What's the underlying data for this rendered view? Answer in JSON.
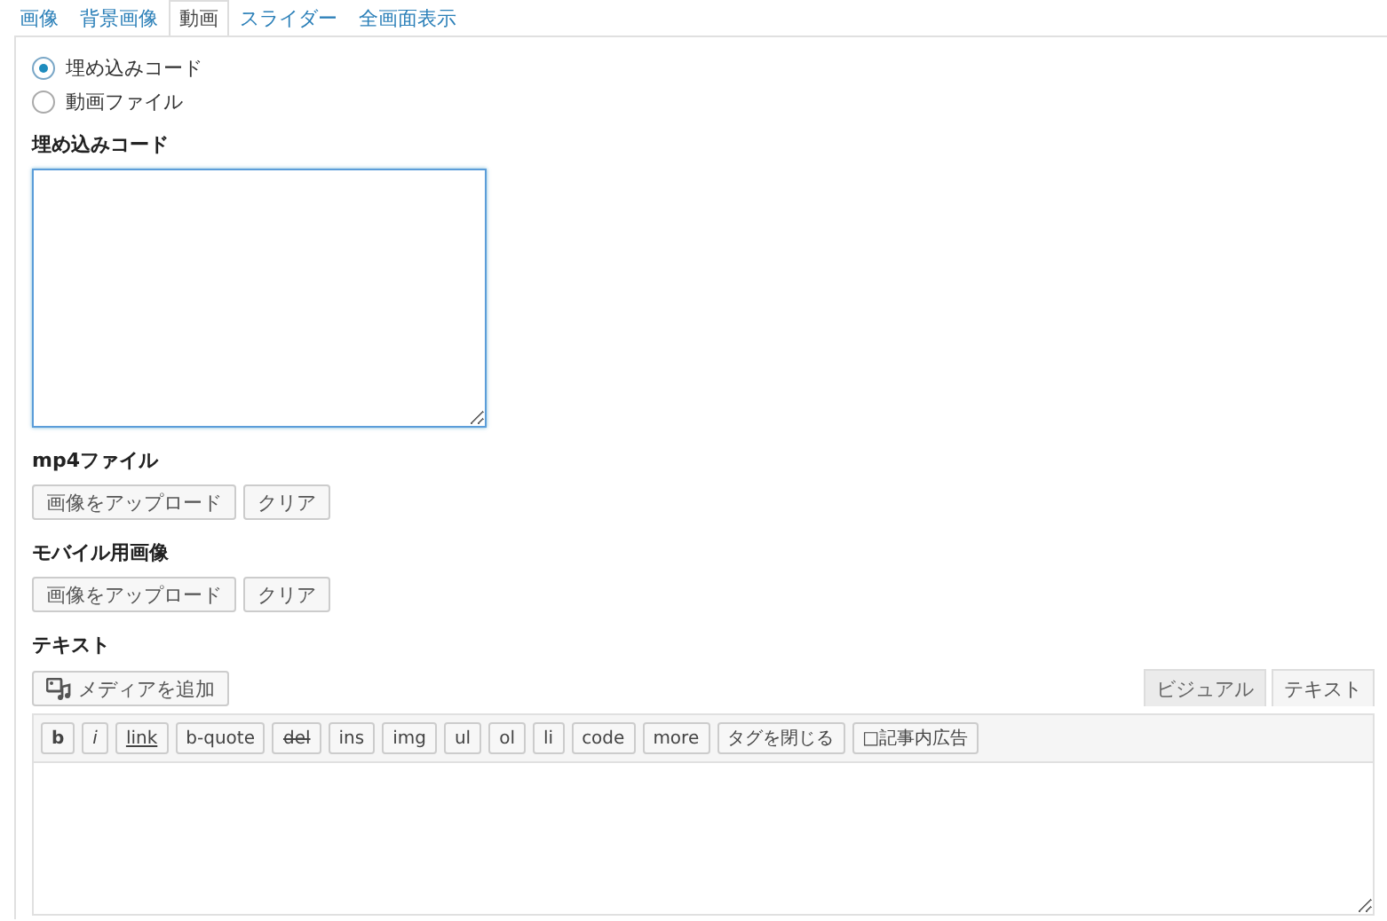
{
  "tabs": [
    {
      "label": "画像",
      "selected": false
    },
    {
      "label": "背景画像",
      "selected": false
    },
    {
      "label": "動画",
      "selected": true
    },
    {
      "label": "スライダー",
      "selected": false
    },
    {
      "label": "全画面表示",
      "selected": false
    }
  ],
  "source_options": [
    {
      "label": "埋め込みコード",
      "selected": true
    },
    {
      "label": "動画ファイル",
      "selected": false
    }
  ],
  "embed_code": {
    "label": "埋め込みコード"
  },
  "upload_groups": [
    {
      "label": "mp4ファイル",
      "upload_button": "画像をアップロード",
      "clear_button": "クリア"
    },
    {
      "label": "モバイル用画像",
      "upload_button": "画像をアップロード",
      "clear_button": "クリア"
    }
  ],
  "text_editor": {
    "label": "テキスト",
    "media_button": "メディアを追加",
    "mode_tabs": [
      {
        "label": "ビジュアル",
        "selected": false
      },
      {
        "label": "テキスト",
        "selected": true
      }
    ],
    "toolbar": [
      {
        "label": "b",
        "kind": "bold"
      },
      {
        "label": "i",
        "kind": "italic"
      },
      {
        "label": "link",
        "kind": "link"
      },
      {
        "label": "b-quote",
        "kind": "plain"
      },
      {
        "label": "del",
        "kind": "strike"
      },
      {
        "label": "ins",
        "kind": "plain"
      },
      {
        "label": "img",
        "kind": "plain"
      },
      {
        "label": "ul",
        "kind": "plain"
      },
      {
        "label": "ol",
        "kind": "plain"
      },
      {
        "label": "li",
        "kind": "plain"
      },
      {
        "label": "code",
        "kind": "plain"
      },
      {
        "label": "more",
        "kind": "plain"
      },
      {
        "label": "タグを閉じる",
        "kind": "plain"
      },
      {
        "label": "□記事内広告",
        "kind": "plain"
      }
    ]
  }
}
